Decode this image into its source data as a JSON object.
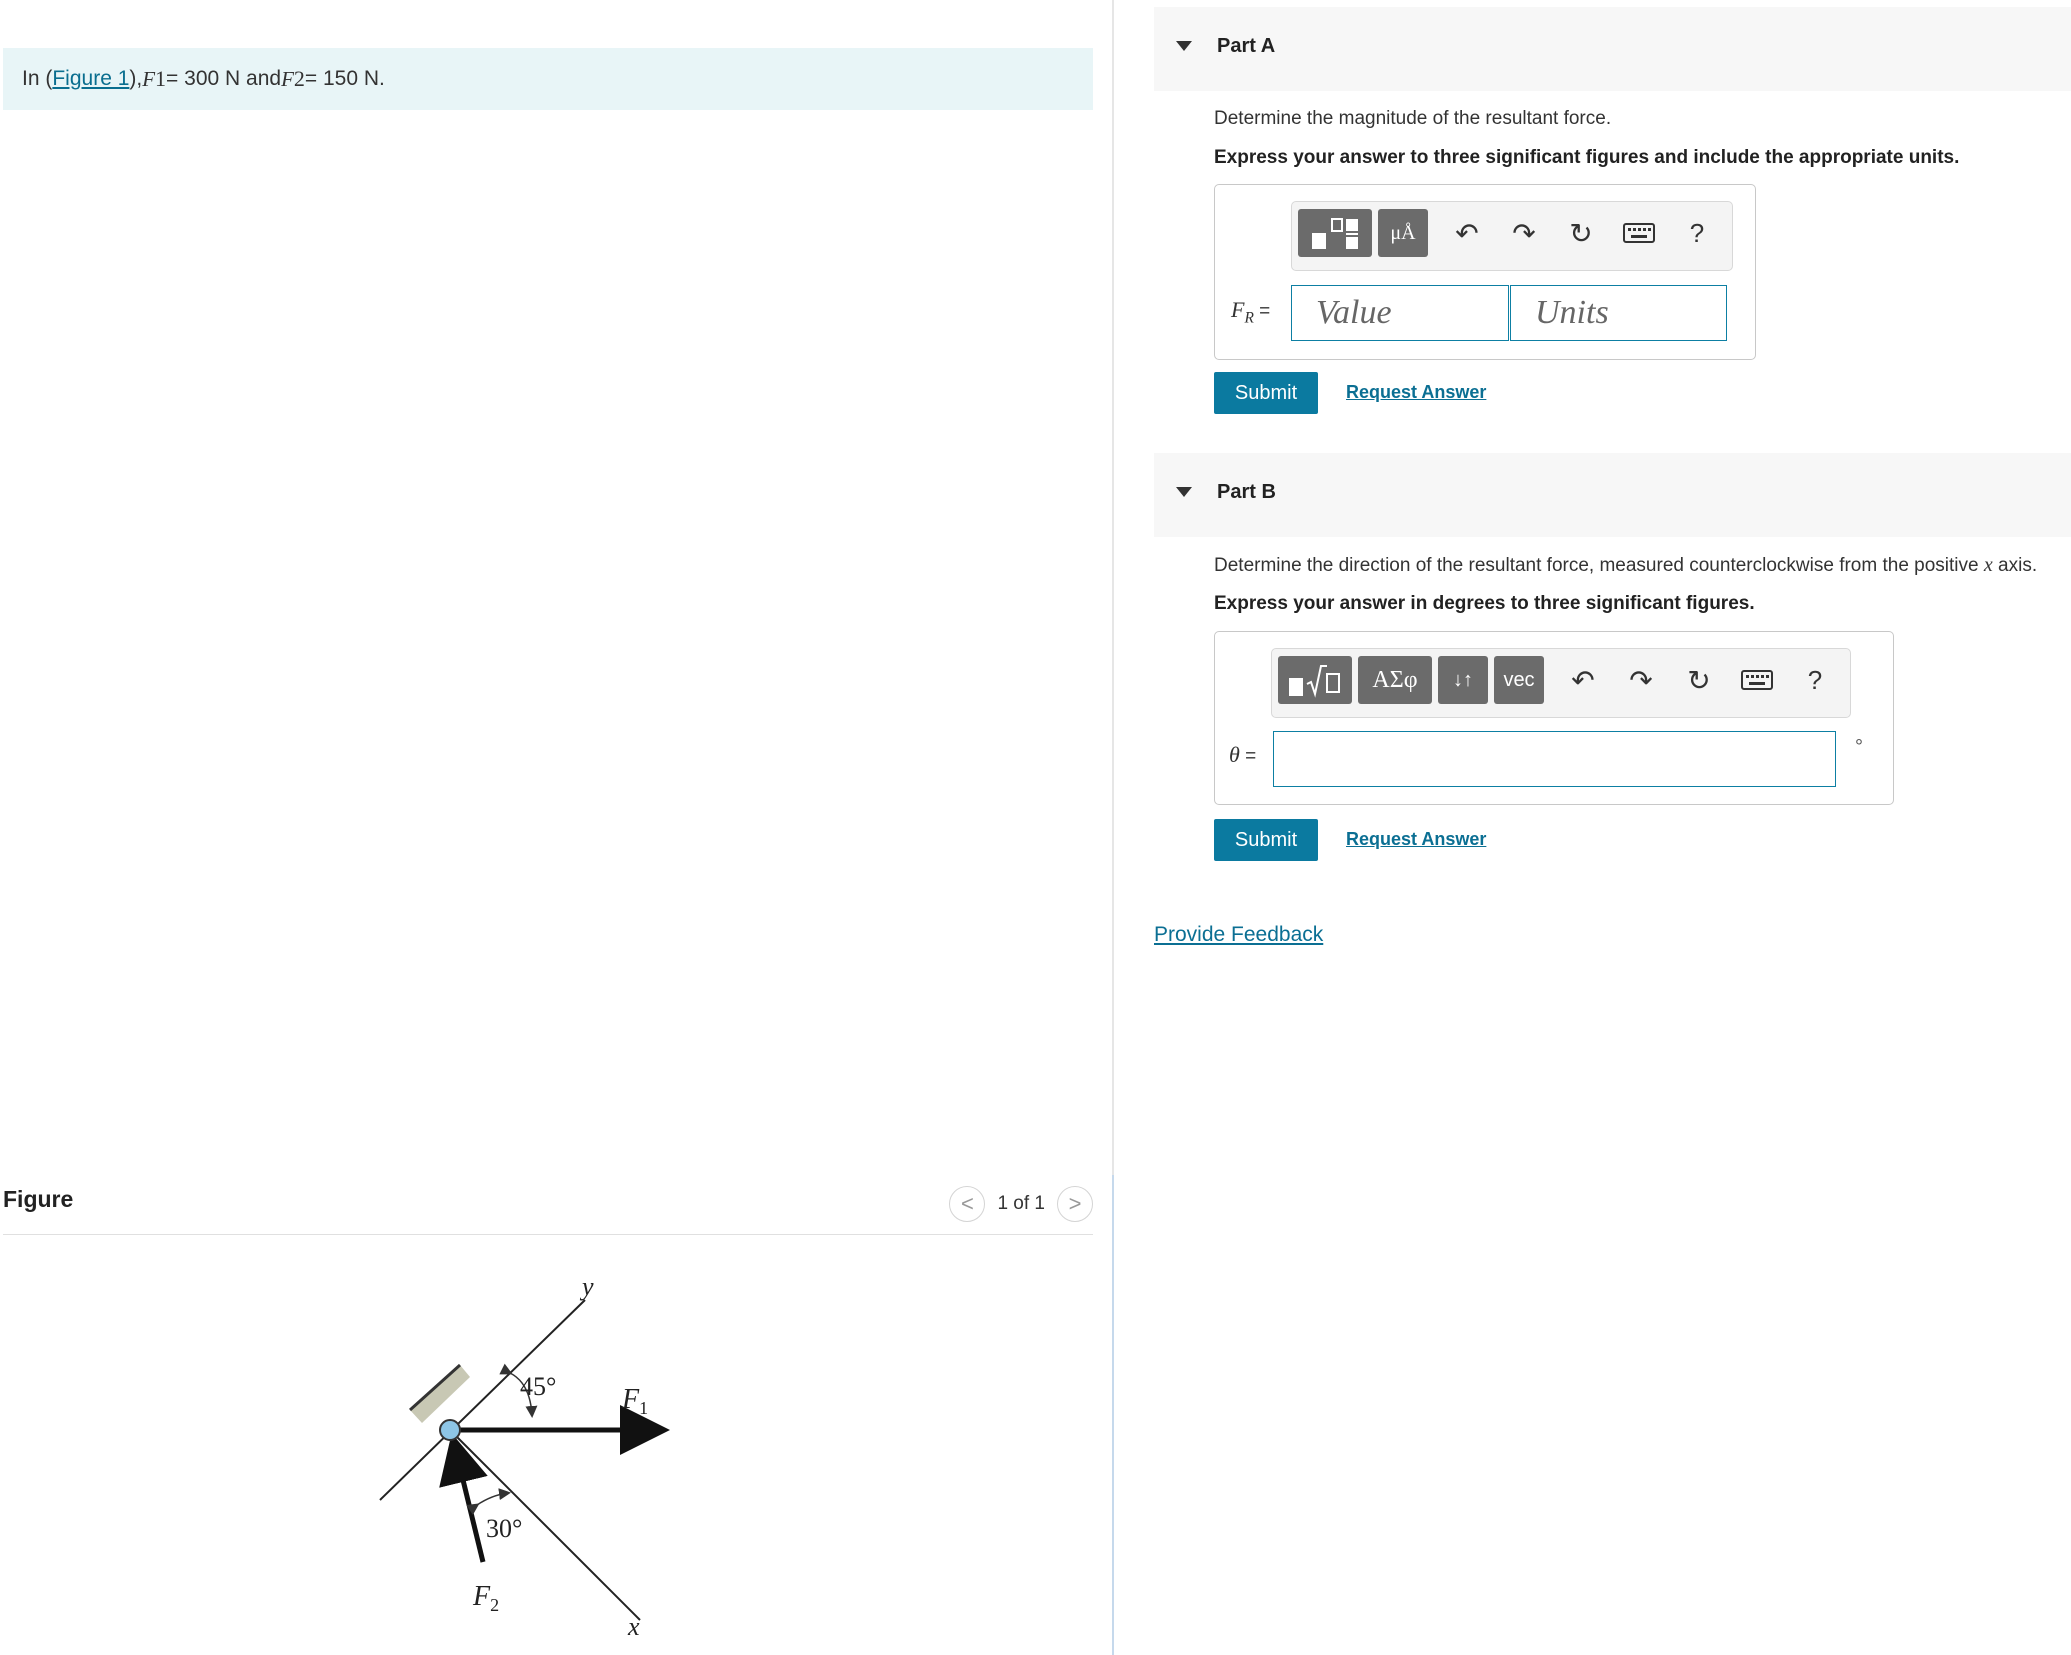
{
  "intro": {
    "prefix": "In (",
    "figure_link": "Figure 1",
    "suffix": "), ",
    "f1_symbol": "F",
    "f1_sub": "1",
    "f1_value": " = 300 N and ",
    "f2_symbol": "F",
    "f2_sub": "2",
    "f2_value": " = 150 N."
  },
  "figure": {
    "title": "Figure",
    "pager": {
      "prev": "<",
      "text": "1 of 1",
      "next": ">"
    },
    "labels": {
      "y": "y",
      "x": "x",
      "angle1": "45°",
      "angle2": "30°",
      "f1": "F",
      "f1_sub": "1",
      "f2": "F",
      "f2_sub": "2"
    }
  },
  "part_a": {
    "label": "Part A",
    "prompt": "Determine the magnitude of the resultant force.",
    "instruction": "Express your answer to three significant figures and include the appropriate units.",
    "var_symbol": "F",
    "var_sub": "R",
    "var_eq": " =",
    "value_placeholder": "Value",
    "units_placeholder": "Units",
    "toolbar": {
      "units_btn": "μÅ",
      "help": "?"
    },
    "submit": "Submit",
    "request": "Request Answer"
  },
  "part_b": {
    "label": "Part B",
    "prompt_pre": "Determine the direction of the resultant force, measured counterclockwise from the positive ",
    "prompt_var": "x",
    "prompt_post": " axis.",
    "instruction": "Express your answer in degrees to three significant figures.",
    "var_symbol": "θ",
    "var_eq": " =",
    "unit": "°",
    "toolbar": {
      "greek_btn": "ΑΣφ",
      "arrows_btn": "↓↑",
      "vec_btn": "vec",
      "help": "?"
    },
    "submit": "Submit",
    "request": "Request Answer"
  },
  "feedback": "Provide Feedback"
}
